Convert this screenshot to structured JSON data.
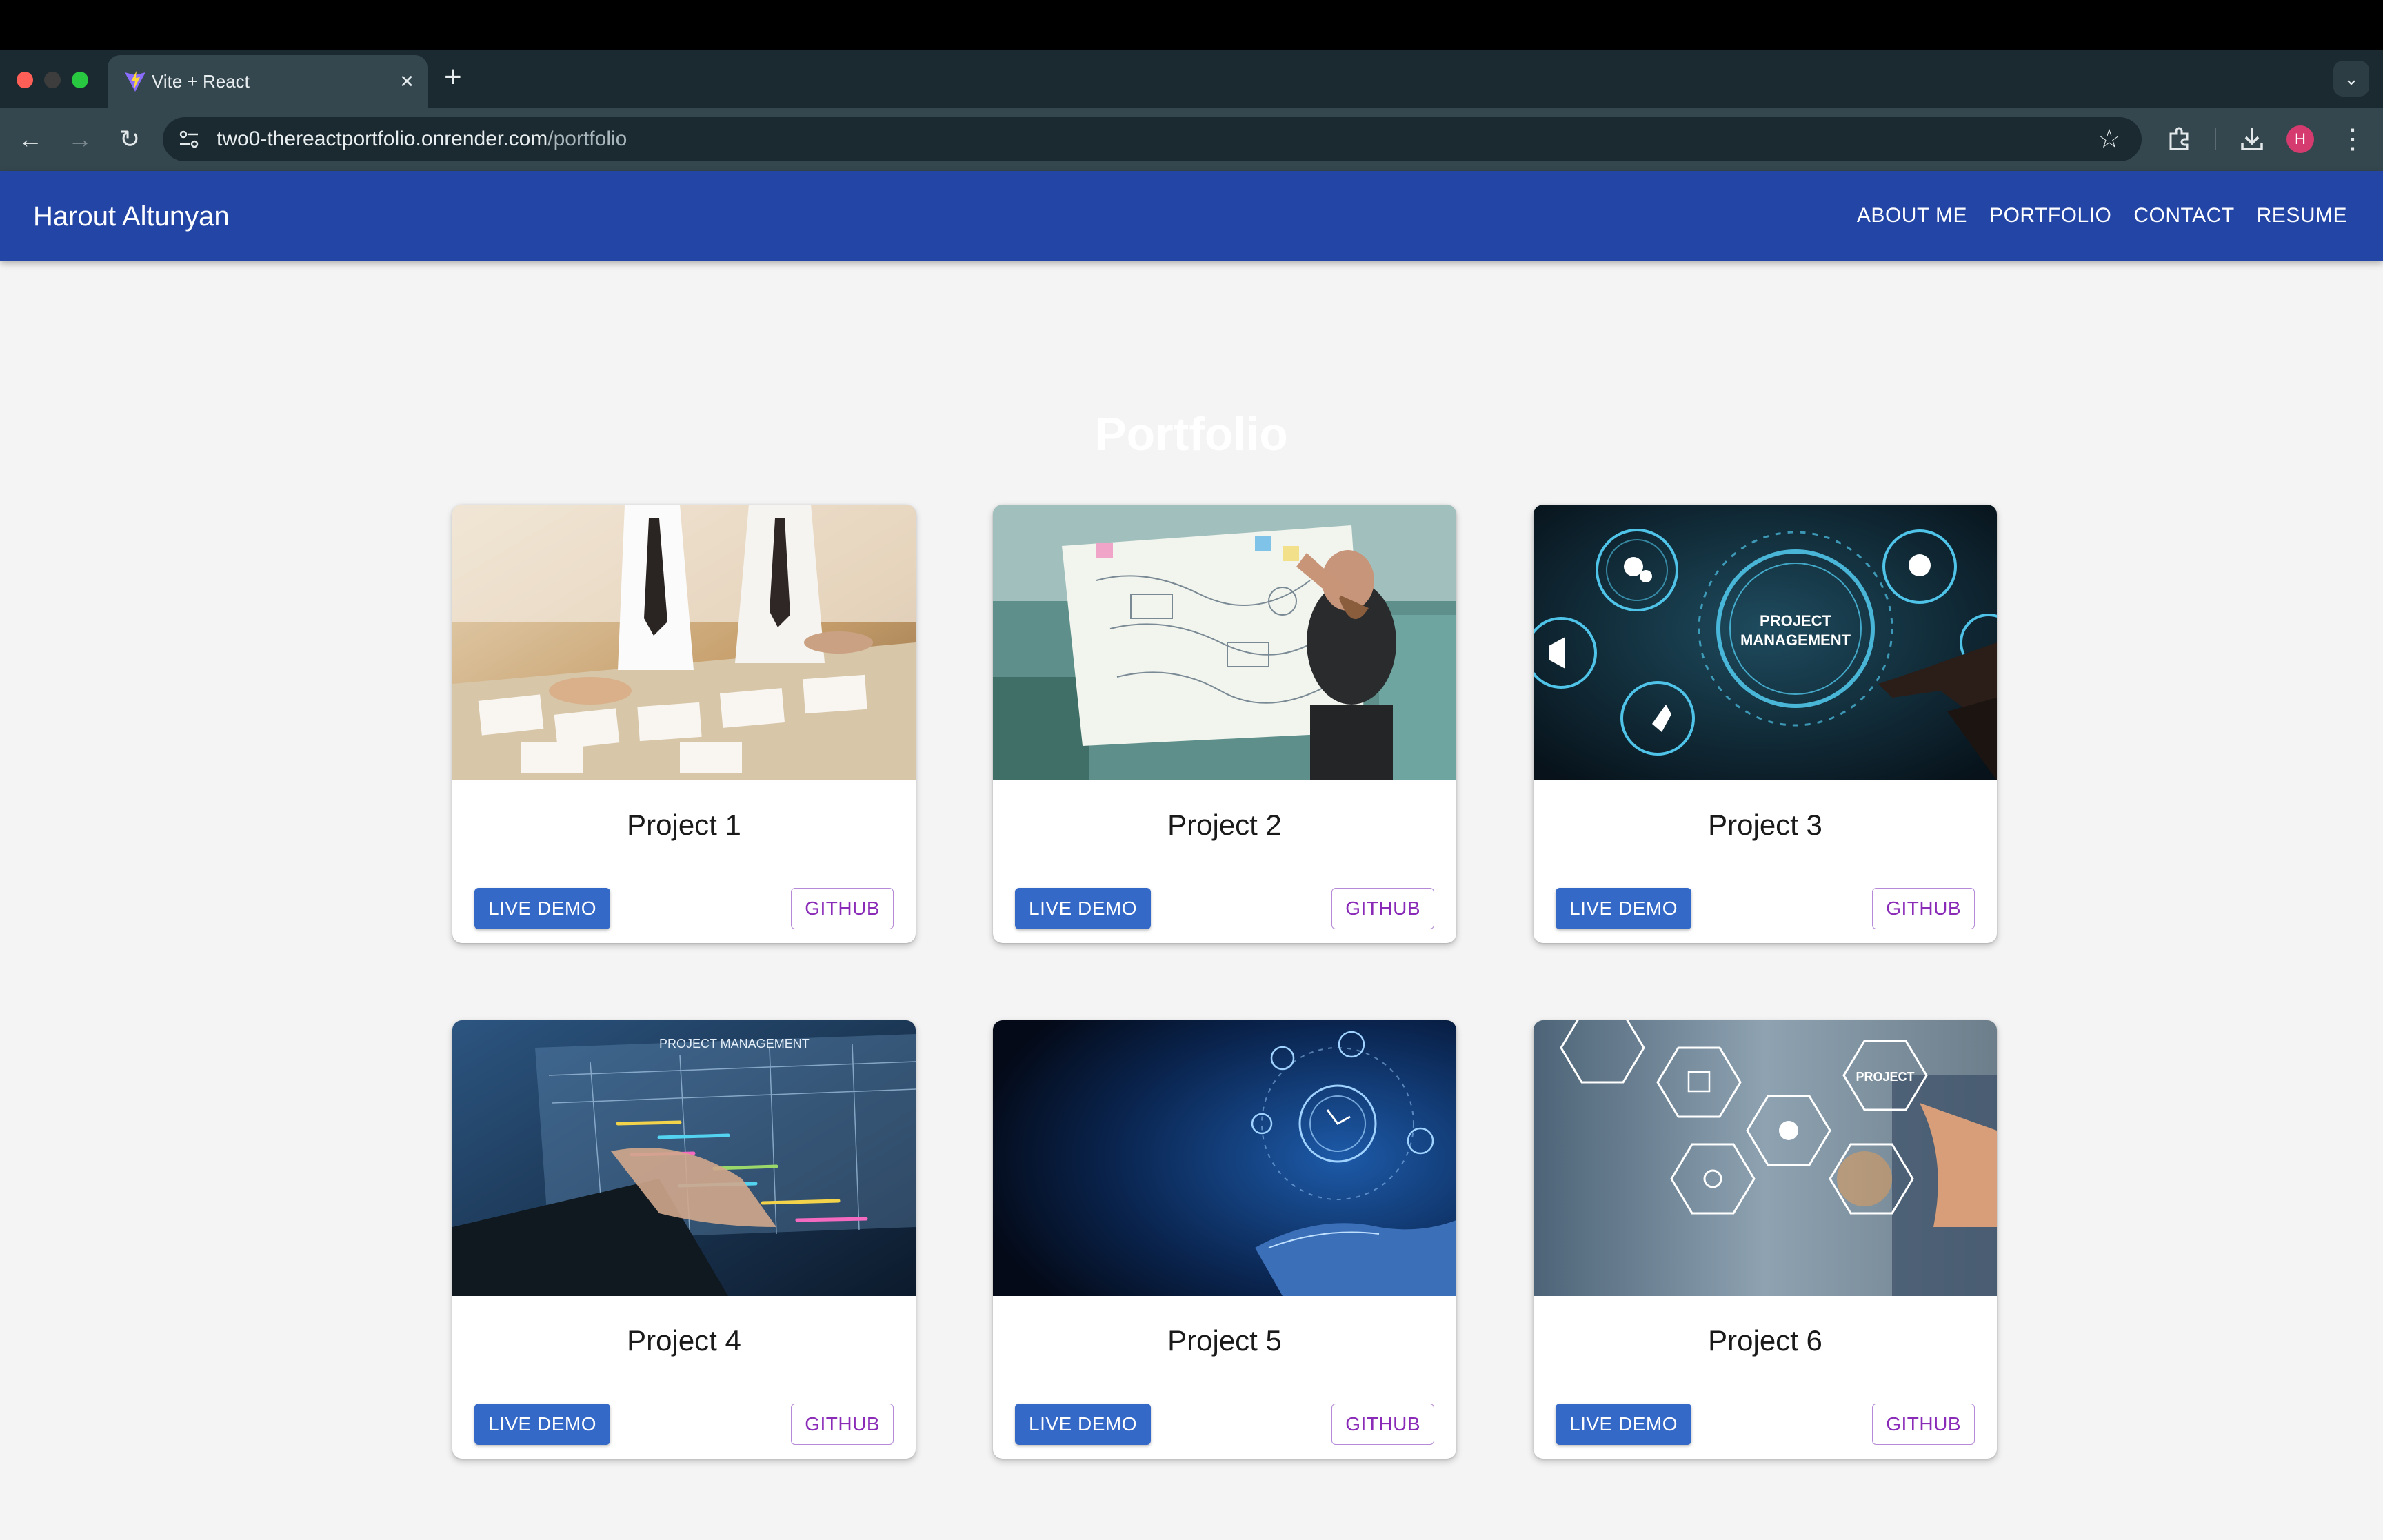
{
  "browser": {
    "tab_title": "Vite + React",
    "url_host": "two0-thereactportfolio.onrender.com",
    "url_path": "/portfolio",
    "profile_initial": "H"
  },
  "site": {
    "brand": "Harout Altunyan",
    "nav": [
      "ABOUT ME",
      "PORTFOLIO",
      "CONTACT",
      "RESUME"
    ],
    "colors": {
      "appbar": "#2345a5",
      "demo_button": "#3569c8",
      "github_button_text": "#8a2bb8"
    }
  },
  "portfolio": {
    "heading": "Portfolio",
    "projects": [
      {
        "title": "Project 1",
        "demo_label": "LIVE DEMO",
        "github_label": "GITHUB",
        "image": "business-documents-photo"
      },
      {
        "title": "Project 2",
        "demo_label": "LIVE DEMO",
        "github_label": "GITHUB",
        "image": "whiteboard-planning-photo"
      },
      {
        "title": "Project 3",
        "demo_label": "LIVE DEMO",
        "github_label": "GITHUB",
        "image": "project-management-hud-photo",
        "image_text": "PROJECT MANAGEMENT"
      },
      {
        "title": "Project 4",
        "demo_label": "LIVE DEMO",
        "github_label": "GITHUB",
        "image": "laptop-gantt-chart-photo",
        "image_text": "PROJECT MANAGEMENT"
      },
      {
        "title": "Project 5",
        "demo_label": "LIVE DEMO",
        "github_label": "GITHUB",
        "image": "hand-holographic-icons-photo"
      },
      {
        "title": "Project 6",
        "demo_label": "LIVE DEMO",
        "github_label": "GITHUB",
        "image": "process-hexagons-photo"
      }
    ]
  }
}
